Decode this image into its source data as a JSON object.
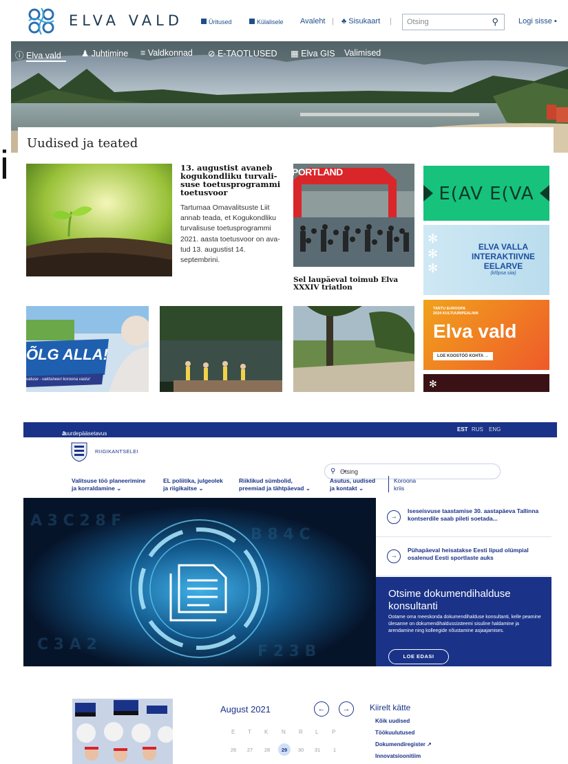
{
  "side_glyph": "i",
  "elva": {
    "site_name": "ELVA VALD",
    "header_links": {
      "events": "Üritused",
      "visitors": "Külalisele",
      "home": "Avaleht",
      "sitemap": "Sisukaart",
      "login": "Logi sisse"
    },
    "search_placeholder": "Otsing",
    "nav": [
      "Elva vald",
      "Juhtimine",
      "Valdkonnad",
      "E-TAOTLUSED",
      "Elva GIS",
      "Valimised"
    ],
    "section_title": "Uudised ja teated",
    "news1": {
      "title": "13. augustist avaneb kogukondliku turvali-suse toetusprogrammi toetusvoor",
      "body": "Tartumaa Omavalitsuste Liit annab teada, et Kogukondliku turvalisuse toetusprogrammi 2021. aasta toetusvoor on ava-tud 13. augustist 14. septembrini."
    },
    "news2": {
      "title": "Sel laupäeval toimub Elva XXXIV triatlon",
      "banner": "PORTLAND"
    },
    "banners": {
      "elav_elva": "E(AV E(VA",
      "eelarve": [
        "ELVA VALLA",
        "INTERAKTIIVNE",
        "EELARVE"
      ],
      "eelarve_sub": "(klõpsa siia)",
      "tartu_small": [
        "TARTU  EUROOPA",
        "2024  KULTUURIPEALINN"
      ],
      "tartu_big": "Elva vald",
      "tartu_btn": "LOE KOOSTÖÖ KOHTA →"
    },
    "tile_olg": "ÕLG ALLA!",
    "tile_olg_sub": "vatuse - vaktsineeri koroona vastu!"
  },
  "rk": {
    "accessibility": "Juurdepääsetavus",
    "languages": [
      "EST",
      "RUS",
      "ENG"
    ],
    "logo_text": "RIIGIKANTSELEI",
    "search_placeholder": "Otsing",
    "nav": [
      [
        "Valitsuse töö planeerimine",
        "ja korraldamine ⌄"
      ],
      [
        "EL poliitika, julgeolek",
        "ja riigikaitse ⌄"
      ],
      [
        "Riiklikud sümbolid,",
        "preemiad ja tähtpäevad ⌄"
      ],
      [
        "Asutus, uudised",
        "ja kontakt ⌄"
      ],
      [
        "Koroona",
        "kriis"
      ]
    ],
    "news": [
      "Iseseisvuse taastamise 30. aastapäeva Tallinna kontserdile saab pileti soetada...",
      "Pühapäeval heisatakse Eesti lipud olümpial osalenud Eesti sportlaste auks"
    ],
    "feature_title": "Otsime dokumendihalduse konsultanti",
    "feature_body": "Ootame oma meeskonda dokumendihalduse konsultanti, kelle peamine ülesanne on dokumendihaldussüsteemi sisuline haldamine ja arendamine ning kolleegide nõustamine asjaajamises.",
    "feature_button": "LOE EDASI",
    "calendar_title": "August 2021",
    "weekdays": [
      "E",
      "T",
      "K",
      "N",
      "R",
      "L",
      "P"
    ],
    "days": [
      "26",
      "27",
      "28",
      "29",
      "30",
      "31",
      "1"
    ],
    "quick_title": "Kiirelt kätte",
    "quick_links": [
      "Kõik uudised",
      "Töökuulutused",
      "Dokumendiregister",
      "Innovatsioonitiim"
    ]
  }
}
